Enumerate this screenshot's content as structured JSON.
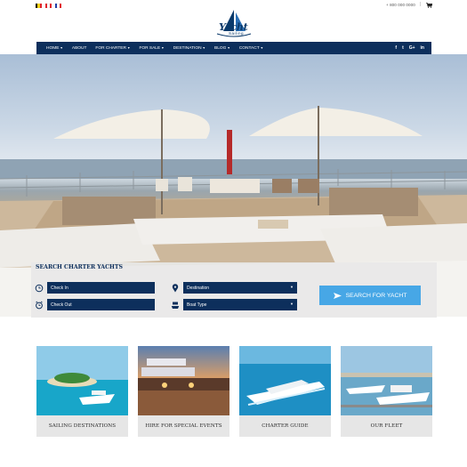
{
  "topbar": {
    "flags": [
      {
        "name": "belgium-flag",
        "colors": [
          "#000000",
          "#f4d21a",
          "#e0232b"
        ]
      },
      {
        "name": "canada-flag",
        "colors": [
          "#e0232b",
          "#ffffff",
          "#e0232b"
        ]
      },
      {
        "name": "france-flag",
        "colors": [
          "#1f3fa8",
          "#ffffff",
          "#e0232b"
        ]
      }
    ],
    "phone": "+ 800 000 0000",
    "separator": "|",
    "cart_icon": "cart-icon"
  },
  "logo": {
    "title": "Yacht",
    "subtitle": "Sailing"
  },
  "nav": {
    "items": [
      {
        "label": "HOME",
        "dropdown": true
      },
      {
        "label": "ABOUT",
        "dropdown": false
      },
      {
        "label": "FOR CHARTER",
        "dropdown": true
      },
      {
        "label": "FOR SALE",
        "dropdown": true
      },
      {
        "label": "DESTINATION",
        "dropdown": true
      },
      {
        "label": "BLOG",
        "dropdown": true
      },
      {
        "label": "CONTACT",
        "dropdown": true
      }
    ],
    "social": [
      {
        "name": "facebook-icon",
        "glyph": "f"
      },
      {
        "name": "twitter-icon",
        "glyph": "t"
      },
      {
        "name": "google-plus-icon",
        "glyph": "G+"
      },
      {
        "name": "linkedin-icon",
        "glyph": "in"
      }
    ]
  },
  "search": {
    "title": "SEARCH CHARTER YACHTS",
    "checkin_placeholder": "Check In",
    "checkout_placeholder": "Check Out",
    "destination_value": "Destination",
    "boat_type_value": "Boat Type",
    "button_label": "SEARCH FOR YACHT"
  },
  "cards": [
    {
      "label": "SAILING DESTINATIONS"
    },
    {
      "label": "HIRE FOR SPECIAL EVENTS"
    },
    {
      "label": "CHARTER GUIDE"
    },
    {
      "label": "OUR FLEET"
    }
  ],
  "colors": {
    "navy": "#0d2f5c",
    "accent_blue": "#47a7e6",
    "search_bg": "#e8e8e8"
  }
}
